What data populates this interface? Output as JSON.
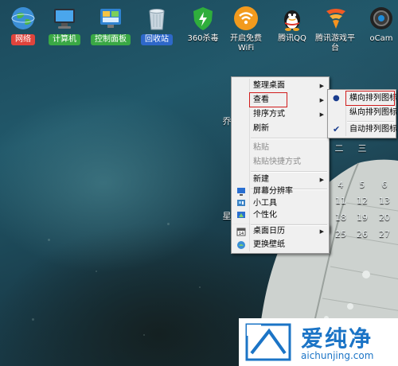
{
  "desktop_icons": [
    {
      "id": "network",
      "label": "网络",
      "icon": "network-globe-icon",
      "badge_color": "#e0443c"
    },
    {
      "id": "computer",
      "label": "计算机",
      "icon": "computer-monitor-icon",
      "badge_color": "#3aa845"
    },
    {
      "id": "control-panel",
      "label": "控制面板",
      "icon": "control-panel-icon",
      "badge_color": "#3aa845"
    },
    {
      "id": "recycle-bin",
      "label": "回收站",
      "icon": "recycle-bin-icon",
      "badge_color": "#2e68c9"
    },
    {
      "id": "360",
      "label": "360杀毒",
      "icon": "shield-360-icon"
    },
    {
      "id": "wifi",
      "label": "开启免费WiFi",
      "icon": "wifi-icon"
    },
    {
      "id": "qq",
      "label": "腾讯QQ",
      "icon": "qq-penguin-icon"
    },
    {
      "id": "games",
      "label": "腾讯游戏平台",
      "icon": "tencent-games-icon"
    },
    {
      "id": "ocam",
      "label": "oCam",
      "icon": "ocam-icon"
    }
  ],
  "context_menu": {
    "items": [
      {
        "label": "整理桌面",
        "submenu": true
      },
      {
        "label": "查看",
        "submenu": true,
        "highlighted": true
      },
      {
        "label": "排序方式",
        "submenu": true
      },
      {
        "label": "刷新"
      },
      {
        "label": "粘贴",
        "disabled": true
      },
      {
        "label": "粘贴快捷方式",
        "disabled": true
      },
      {
        "label": "新建",
        "submenu": true
      },
      {
        "label": "屏幕分辨率",
        "icon": "display-icon"
      },
      {
        "label": "小工具",
        "icon": "gadgets-icon"
      },
      {
        "label": "个性化",
        "icon": "personalize-icon"
      },
      {
        "label": "桌面日历",
        "submenu": true,
        "icon": "calendar-icon"
      },
      {
        "label": "更换壁纸",
        "icon": "wallpaper-icon"
      }
    ]
  },
  "view_submenu": {
    "items": [
      {
        "label": "横向排列图标",
        "mark": "bullet",
        "highlighted": true
      },
      {
        "label": "纵向排列图标"
      },
      {
        "label": "自动排列图标",
        "mark": "check"
      }
    ]
  },
  "calendar_gadget": {
    "day_labels": [
      "二",
      "三"
    ],
    "dates": [
      "4",
      "5",
      "6",
      "11",
      "12",
      "13",
      "18",
      "19",
      "20",
      "25",
      "26",
      "27"
    ],
    "left_glyphs": [
      "乔",
      "星"
    ]
  },
  "watermark": {
    "brand": "爱纯净",
    "url": "aichunjing.com"
  },
  "colors": {
    "menu_highlight_border": "#d11c1c",
    "menu_bg": "#f0f0f0",
    "watermark_blue": "#1b74c6"
  }
}
